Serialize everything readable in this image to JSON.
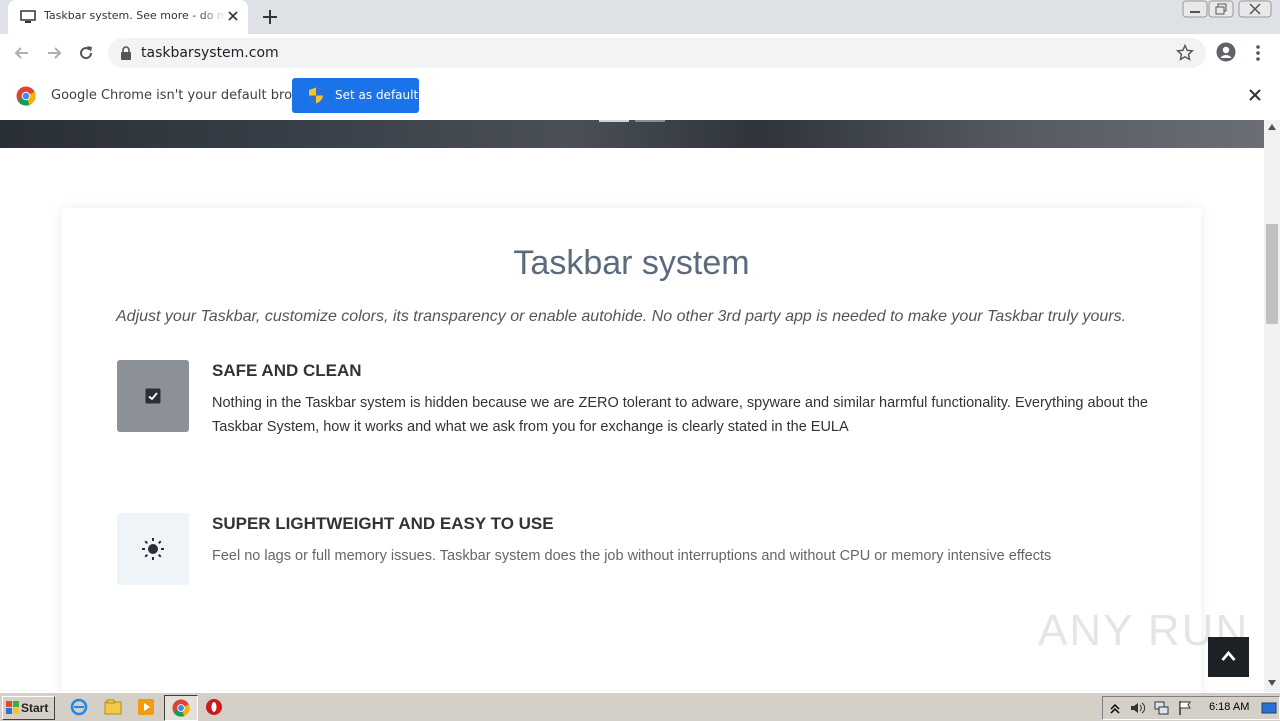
{
  "browser": {
    "tab_title": "Taskbar system. See more - do more",
    "url": "taskbarsystem.com"
  },
  "infobar": {
    "message": "Google Chrome isn't your default browser",
    "button_label": "Set as default"
  },
  "page": {
    "title": "Taskbar system",
    "lead": "Adjust your Taskbar, customize colors, its transparency or enable autohide. No other 3rd party app is needed to make your Taskbar truly yours.",
    "features": [
      {
        "title": "SAFE AND CLEAN",
        "description": "Nothing in the Taskbar system is hidden because we are ZERO tolerant to adware, spyware and similar harmful functionality. Everything about the Taskbar System, how it works and what we ask from you for exchange is clearly stated in the EULA",
        "icon": "checkbox-icon"
      },
      {
        "title": "SUPER LIGHTWEIGHT AND EASY TO USE",
        "description": "Feel no lags or full memory issues. Taskbar system does the job without interruptions and without CPU or memory intensive effects",
        "icon": "sun-icon"
      }
    ]
  },
  "watermark": "ANY RUN",
  "taskbar": {
    "start_label": "Start",
    "clock": "6:18 AM"
  },
  "colors": {
    "accent": "#1a73e8",
    "heading": "#5b6b7d",
    "taskbar": "#d4d0c8"
  }
}
